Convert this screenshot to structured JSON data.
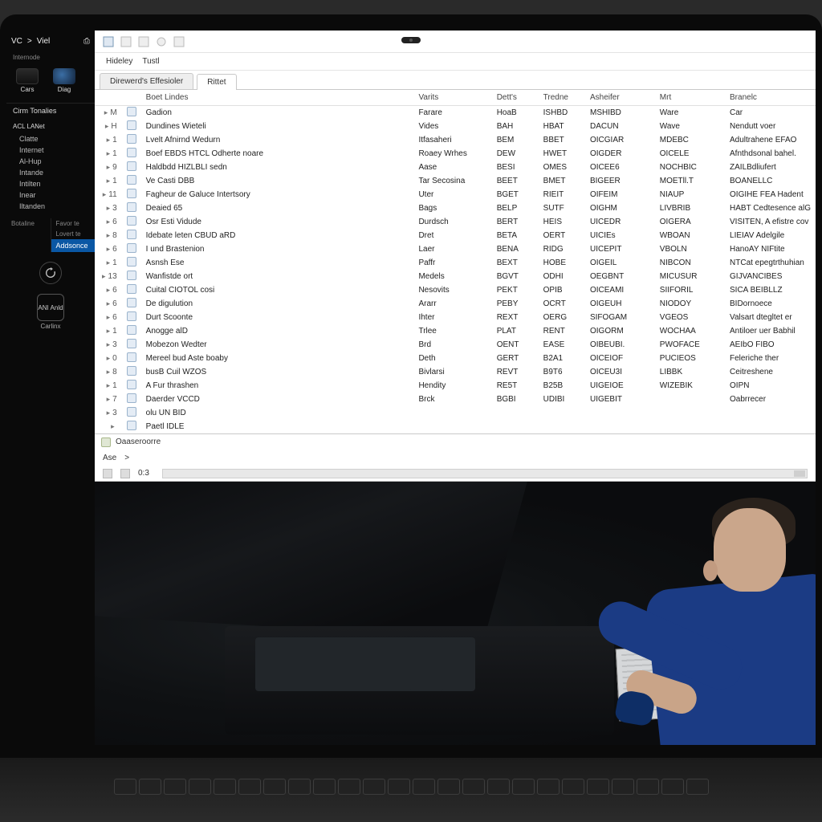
{
  "os": {
    "top": {
      "brand": "VC",
      "sep": ">",
      "menu": "Viel",
      "iconSlot": "⎙"
    },
    "brandline": "Internode",
    "tiles": [
      {
        "label": "Cars"
      },
      {
        "label": "Diag"
      }
    ],
    "section": "Cirm Tonalies",
    "groupLabel": "ACL  LANet",
    "items": [
      "Clatte",
      "Internet",
      "Al-Hup",
      "Intande",
      "Intilten",
      "Inear",
      "Iltanden"
    ],
    "splitLeft": "Botaline",
    "splitLeftItems": [
      "Favor te",
      "Lovert te"
    ],
    "splitRight": "Addsonce",
    "square": "ANI\nAnld",
    "bottom": "Carlinx"
  },
  "app": {
    "toolbar": {
      "a": "Hideley",
      "b": "Tustl"
    },
    "tabs": {
      "header": "Direwerd's Effesioler",
      "active": "Rittet"
    },
    "columns": [
      "",
      "",
      "Boet Lindes",
      "Varits",
      "Dett's",
      "Tredne",
      "Asheifer",
      "Mrt",
      "Branelc"
    ],
    "rows": [
      {
        "ix": "M",
        "name": "Gadion",
        "type": "Farare",
        "a": "HoaB",
        "b": "ISHBD",
        "c": "MSHIBD",
        "d": "Ware",
        "e": "Car"
      },
      {
        "ix": "H",
        "name": "Dundines Wieteli",
        "type": "Vides",
        "a": "BAH",
        "b": "HBAT",
        "c": "DACUN",
        "d": "Wave",
        "e": "Nendutt voer"
      },
      {
        "ix": "1",
        "name": "Lvelt Afnirnd Wedurn",
        "type": "Itfasaheri",
        "a": "BEM",
        "b": "BBET",
        "c": "OICGIAR",
        "d": "MDEBC",
        "e": "Adultrahene EFAO"
      },
      {
        "ix": "1",
        "name": "Boef EBDS HTCL Odherte noare",
        "type": "Roaey Wrhes",
        "a": "DEW",
        "b": "HWET",
        "c": "OIGDER",
        "d": "OICELE",
        "e": "Afnthdsonal bahel."
      },
      {
        "ix": "9",
        "name": "Haldbdd HIZLBLI sedn",
        "type": "Aase",
        "a": "BESI",
        "b": "OMES",
        "c": "OICEE6",
        "d": "NOCHBIC",
        "e": "ZAILBdliufert"
      },
      {
        "ix": "1",
        "name": "Ve Casti DBB",
        "type": "Tar Secosina",
        "a": "BEET",
        "b": "BMET",
        "c": "BIGEER",
        "d": "MOETll.T",
        "e": "BOANELLC"
      },
      {
        "ix": "11",
        "name": "Fagheur de Galuce Intertsory",
        "type": "Uter",
        "a": "BGET",
        "b": "RIEIT",
        "c": "OIFEIM",
        "d": "NIAUP",
        "e": "OIGIHE FEA Hadent"
      },
      {
        "ix": "3",
        "name": "Deaied 65",
        "type": "Bags",
        "a": "BELP",
        "b": "SUTF",
        "c": "OIGHM",
        "d": "LIVBRIB",
        "e": "HABT Cedtesence alG"
      },
      {
        "ix": "6",
        "name": "Osr Esti Vidude",
        "type": "Durdsch",
        "a": "BERT",
        "b": "HEIS",
        "c": "UICEDR",
        "d": "OIGERA",
        "e": "VISITEN, A efistre cov"
      },
      {
        "ix": "8",
        "name": "Idebate leten CBUD aRD",
        "type": "Dret",
        "a": "BETA",
        "b": "OERT",
        "c": "UICIEs",
        "d": "WBOAN",
        "e": "LIEIAV Adelgile"
      },
      {
        "ix": "6",
        "name": "I und Brastenion",
        "type": "Laer",
        "a": "BENA",
        "b": "RIDG",
        "c": "UICEPIT",
        "d": "VBOLN",
        "e": "HanoAY NIFtite"
      },
      {
        "ix": "1",
        "name": "Asnsh Ese",
        "type": "Paffr",
        "a": "BEXT",
        "b": "HOBE",
        "c": "OIGEIL",
        "d": "NIBCON",
        "e": "NTCat epegtrthuhian"
      },
      {
        "ix": "13",
        "name": "Wanfistde ort",
        "type": "Medels",
        "a": "BGVT",
        "b": "ODHI",
        "c": "OEGBNT",
        "d": "MICUSUR",
        "e": "GIJVANCIBES"
      },
      {
        "ix": "6",
        "name": "Cuital CIOTOL cosi",
        "type": "Nesovits",
        "a": "PEKT",
        "b": "OPIB",
        "c": "OICEAMI",
        "d": "SIIFORIL",
        "e": "SICA BEIBLLZ"
      },
      {
        "ix": "6",
        "name": "De digulution",
        "type": "Ararr",
        "a": "PEBY",
        "b": "OCRT",
        "c": "OIGEUH",
        "d": "NIODOY",
        "e": "BIDornoece"
      },
      {
        "ix": "6",
        "name": "Durt Scoonte",
        "type": "Ihter",
        "a": "REXT",
        "b": "OERG",
        "c": "SIFOGAM",
        "d": "VGEOS",
        "e": "Valsart dtegltet er"
      },
      {
        "ix": "1",
        "name": "Anogge alD",
        "type": "Trlee",
        "a": "PLAT",
        "b": "RENT",
        "c": "OIGORM",
        "d": "WOCHAA",
        "e": "Antiloer uer Babhil"
      },
      {
        "ix": "3",
        "name": "Mobezon Wedter",
        "type": "Brd",
        "a": "OENT",
        "b": "EASE",
        "c": "OIBEUBI.",
        "d": "PWOFACE",
        "e": "AEIbO FIBO"
      },
      {
        "ix": "0",
        "name": "Mereel bud Aste boaby",
        "type": "Deth",
        "a": "GERT",
        "b": "B2A1",
        "c": "OICEIOF",
        "d": "PUCIEOS",
        "e": "Feleriche ther"
      },
      {
        "ix": "8",
        "name": "busB Cuil WZOS",
        "type": "Bivlarsi",
        "a": "REVT",
        "b": "B9T6",
        "c": "OICEU3I",
        "d": "LIBBK",
        "e": "Ceitreshene"
      },
      {
        "ix": "1",
        "name": "A Fur thrashen",
        "type": "Hendity",
        "a": "RE5T",
        "b": "B25B",
        "c": "UIGEIOE",
        "d": "WIZEBIK",
        "e": "OIPN"
      },
      {
        "ix": "7",
        "name": "Daerder VCCD",
        "type": "Brck",
        "a": "BGBI",
        "b": "UDIBI",
        "c": "UIGEBIT",
        "d": "",
        "e": "Oabrrecer"
      },
      {
        "ix": "3",
        "name": "olu UN BID",
        "type": "",
        "a": "",
        "b": "",
        "c": "",
        "d": "",
        "e": ""
      },
      {
        "ix": "",
        "name": "Paetl IDLE",
        "type": "",
        "a": "",
        "b": "",
        "c": "",
        "d": "",
        "e": ""
      }
    ],
    "divider": "Oaaseroorre",
    "subtabs": {
      "a": "Ase",
      "b": ">"
    },
    "subtoolbar": {
      "a": "0:3"
    }
  }
}
